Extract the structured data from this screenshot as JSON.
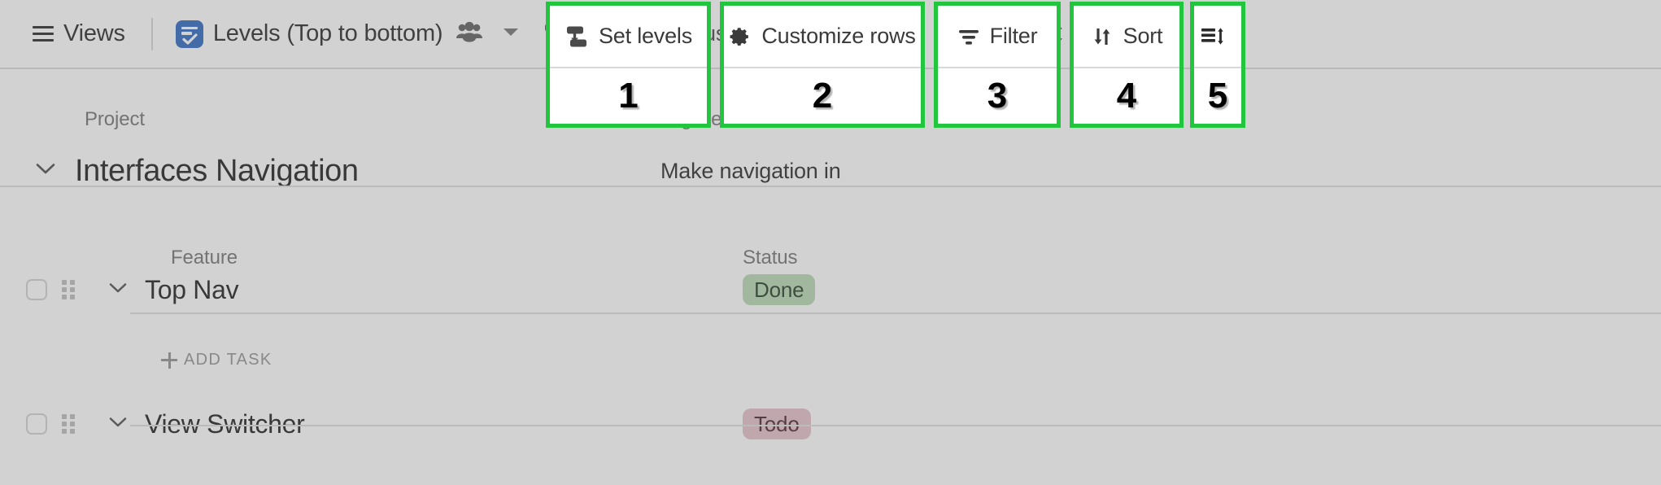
{
  "colors": {
    "annotation_green": "#22c53e",
    "levels_icon_blue": "#1f5fbe",
    "done_badge_bg": "#b4d7ae",
    "todo_badge_bg": "#e3bcc5",
    "toolbar_text": "#3a3a3a",
    "page_bg": "#ffffff",
    "dim_overlay": "rgba(130,130,130,0.36)"
  },
  "toolbar": {
    "views_label": "Views",
    "views_icon": "hamburger-menu-icon",
    "levels_icon": "levels-list-check-icon",
    "levels_label": "Levels (Top to bottom)",
    "people_icon": "people-group-icon",
    "caret_icon": "caret-down-icon",
    "actions": [
      {
        "id": "set-levels",
        "label": "Set levels",
        "icon": "set-levels-icon",
        "number": "1"
      },
      {
        "id": "customize-rows",
        "label": "Customize rows",
        "icon": "gear-icon",
        "number": "2"
      },
      {
        "id": "filter",
        "label": "Filter",
        "icon": "filter-icon",
        "number": "3"
      },
      {
        "id": "sort",
        "label": "Sort",
        "icon": "sort-arrows-icon",
        "number": "4"
      },
      {
        "id": "row-height",
        "label": "",
        "icon": "row-height-icon",
        "number": "5"
      }
    ]
  },
  "sheet": {
    "column_headers": {
      "project": "Project",
      "tagline": "Tagline",
      "feature": "Feature",
      "status": "Status"
    },
    "project": {
      "chevron": "chevron-down-icon",
      "name": "Interfaces Navigation",
      "tagline": "Make navigation in"
    },
    "tasks": [
      {
        "chevron": "chevron-down-icon",
        "checkbox": "row-checkbox",
        "grip": "drag-handle-icon",
        "name": "Top Nav",
        "status": "Done",
        "status_kind": "done"
      },
      {
        "chevron": "chevron-down-icon",
        "checkbox": "row-checkbox",
        "grip": "drag-handle-icon",
        "name": "View Switcher",
        "status": "Todo",
        "status_kind": "todo"
      }
    ],
    "add_task_label": "ADD TASK",
    "add_task_icon": "plus-icon"
  }
}
